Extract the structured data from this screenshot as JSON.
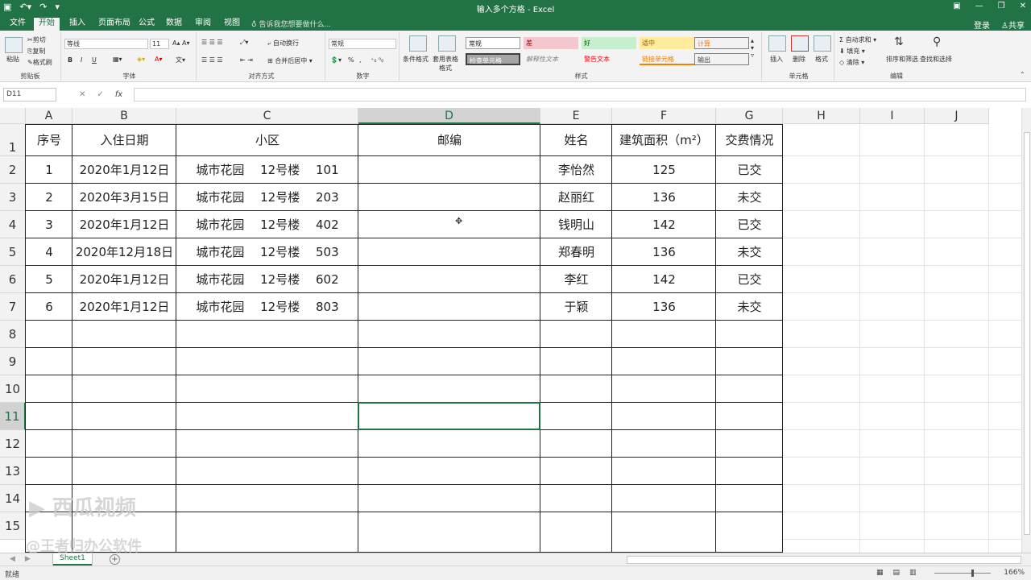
{
  "window": {
    "title": "输入多个方格 - Excel",
    "qat": [
      "save-icon",
      "undo-icon",
      "redo-icon",
      "customize-icon"
    ],
    "controls": [
      "ribbon-display-icon",
      "minimize-icon",
      "restore-icon",
      "close-icon"
    ]
  },
  "tabs": {
    "items": [
      "文件",
      "开始",
      "插入",
      "页面布局",
      "公式",
      "数据",
      "审阅",
      "视图"
    ],
    "active": "开始",
    "tell_me": "告诉我您想要做什么...",
    "login": "登录",
    "share": "共享"
  },
  "ribbon": {
    "clipboard": {
      "paste": "粘贴",
      "cut": "剪切",
      "copy": "复制",
      "format_painter": "格式刷",
      "label": "剪贴板"
    },
    "font": {
      "name": "等线",
      "size": "11",
      "bold": "B",
      "italic": "I",
      "underline": "U",
      "label": "字体"
    },
    "alignment": {
      "wrap": "自动换行",
      "merge": "合并后居中",
      "label": "对齐方式"
    },
    "number": {
      "format": "常规",
      "percent": "%",
      "comma": ",",
      "label": "数字"
    },
    "styles": {
      "conditional": "条件格式",
      "table": "套用表格格式",
      "cells": [
        {
          "text": "常规",
          "bg": "#ffffff",
          "fg": "#222222"
        },
        {
          "text": "差",
          "bg": "#f4c7ce",
          "fg": "#9c0006"
        },
        {
          "text": "好",
          "bg": "#c6efce",
          "fg": "#006100"
        },
        {
          "text": "适中",
          "bg": "#ffeb9c",
          "fg": "#9c5700"
        },
        {
          "text": "计算",
          "bg": "#f2f2f2",
          "fg": "#fa7d00"
        },
        {
          "text": "检查单元格",
          "bg": "#a5a5a5",
          "fg": "#ffffff"
        },
        {
          "text": "解释性文本",
          "bg": "#f3f3f3",
          "fg": "#7f7f7f"
        },
        {
          "text": "警告文本",
          "bg": "#f3f3f3",
          "fg": "#ff0000"
        },
        {
          "text": "链接单元格",
          "bg": "#f3f3f3",
          "fg": "#fa7d00"
        },
        {
          "text": "输出",
          "bg": "#f2f2f2",
          "fg": "#3f3f3f"
        }
      ],
      "label": "样式"
    },
    "cells": {
      "insert": "插入",
      "delete": "删除",
      "format": "格式",
      "label": "单元格"
    },
    "editing": {
      "autosum": "自动求和",
      "fill": "填充",
      "clear": "清除",
      "sort": "排序和筛选",
      "find": "查找和选择",
      "label": "编辑"
    }
  },
  "formula_bar": {
    "name_box": "D11",
    "fx": "fx",
    "value": ""
  },
  "sheet": {
    "columns": [
      "A",
      "B",
      "C",
      "D",
      "E",
      "F",
      "G",
      "H",
      "I",
      "J"
    ],
    "selected_col": "D",
    "selected_row": 11,
    "rows": [
      "1",
      "2",
      "3",
      "4",
      "5",
      "6",
      "7",
      "8",
      "9",
      "10",
      "11",
      "12",
      "13",
      "14",
      "15"
    ],
    "headers": [
      "序号",
      "入住日期",
      "小区",
      "邮编",
      "姓名",
      "建筑面积（m²）",
      "交费情况"
    ],
    "data": [
      [
        "1",
        "2020年1月12日",
        "城市花园　 12号楼　 101",
        "",
        "李怡然",
        "125",
        "已交"
      ],
      [
        "2",
        "2020年3月15日",
        "城市花园　 12号楼　 203",
        "",
        "赵丽红",
        "136",
        "未交"
      ],
      [
        "3",
        "2020年1月12日",
        "城市花园　 12号楼　 402",
        "",
        "钱明山",
        "142",
        "已交"
      ],
      [
        "4",
        "2020年12月18日",
        "城市花园　 12号楼　 503",
        "",
        "郑春明",
        "136",
        "未交"
      ],
      [
        "5",
        "2020年1月12日",
        "城市花园　 12号楼　 602",
        "",
        "李红",
        "142",
        "已交"
      ],
      [
        "6",
        "2020年1月12日",
        "城市花园　 12号楼　 803",
        "",
        "于颖",
        "136",
        "未交"
      ]
    ]
  },
  "sheet_tabs": {
    "active": "Sheet1",
    "add": "+"
  },
  "status": {
    "ready": "就绪",
    "zoom": "166%"
  },
  "watermark": {
    "line1": "西瓜视频",
    "line2": "@王者归办公软件"
  }
}
